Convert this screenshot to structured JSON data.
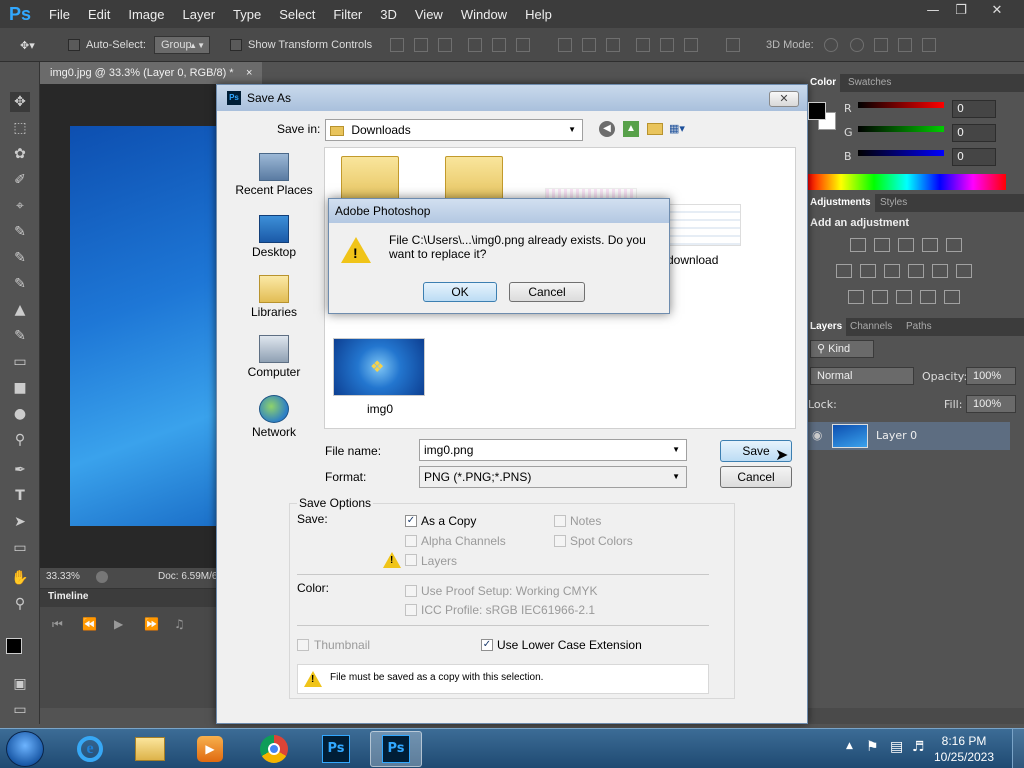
{
  "app": {
    "logo": "Ps",
    "menu": [
      "File",
      "Edit",
      "Image",
      "Layer",
      "Type",
      "Select",
      "Filter",
      "3D",
      "View",
      "Window",
      "Help"
    ]
  },
  "options_bar": {
    "auto_select_label": "Auto-Select:",
    "auto_select_value": "Group",
    "show_transform_label": "Show Transform Controls",
    "mode_label": "3D Mode:"
  },
  "document": {
    "tab_title": "img0.jpg @ 33.3% (Layer 0, RGB/8) *",
    "zoom": "33.33%",
    "doc_info": "Doc: 6.59M/6",
    "timeline_label": "Timeline"
  },
  "panels": {
    "color_tabs": [
      "Color",
      "Swatches"
    ],
    "channels": [
      {
        "label": "R",
        "value": "0"
      },
      {
        "label": "G",
        "value": "0"
      },
      {
        "label": "B",
        "value": "0"
      }
    ],
    "adjust_tabs": [
      "Adjustments",
      "Styles"
    ],
    "add_adjustment": "Add an adjustment",
    "layer_tabs": [
      "Layers",
      "Channels",
      "Paths"
    ],
    "kind_label": "Kind",
    "blend_mode": "Normal",
    "opacity_label": "Opacity:",
    "opacity_value": "100%",
    "lock_label": "Lock:",
    "fill_label": "Fill:",
    "fill_value": "100%",
    "layer_name": "Layer 0"
  },
  "save_dialog": {
    "title": "Save As",
    "save_in_label": "Save in:",
    "save_in_value": "Downloads",
    "places": [
      "Recent Places",
      "Desktop",
      "Libraries",
      "Computer",
      "Network"
    ],
    "files": [
      {
        "name": "download"
      },
      {
        "name": "img0"
      }
    ],
    "file_name_label": "File name:",
    "file_name_value": "img0.png",
    "format_label": "Format:",
    "format_value": "PNG (*.PNG;*.PNS)",
    "save_button": "Save",
    "cancel_button": "Cancel",
    "save_options_title": "Save Options",
    "save_label": "Save:",
    "options": {
      "as_a_copy": "As a Copy",
      "notes": "Notes",
      "alpha_channels": "Alpha Channels",
      "spot_colors": "Spot Colors",
      "layers": "Layers"
    },
    "color_label": "Color:",
    "use_proof_setup": "Use Proof Setup:  Working CMYK",
    "icc_profile": "ICC Profile:  sRGB IEC61966-2.1",
    "thumbnail": "Thumbnail",
    "lower_case_ext": "Use Lower Case Extension",
    "warning_message": "File must be saved as a copy with this selection."
  },
  "alert": {
    "title": "Adobe Photoshop",
    "message_line1": "File C:\\Users\\...\\img0.png already exists.  Do you",
    "message_line2": "want to replace it?",
    "ok_button": "OK",
    "cancel_button": "Cancel"
  },
  "taskbar": {
    "time": "8:16 PM",
    "date": "10/25/2023"
  },
  "colors": {
    "ps_blue": "#31a8ff",
    "dialog_bg": "#f0f0f0",
    "panel_bg": "#535353"
  }
}
